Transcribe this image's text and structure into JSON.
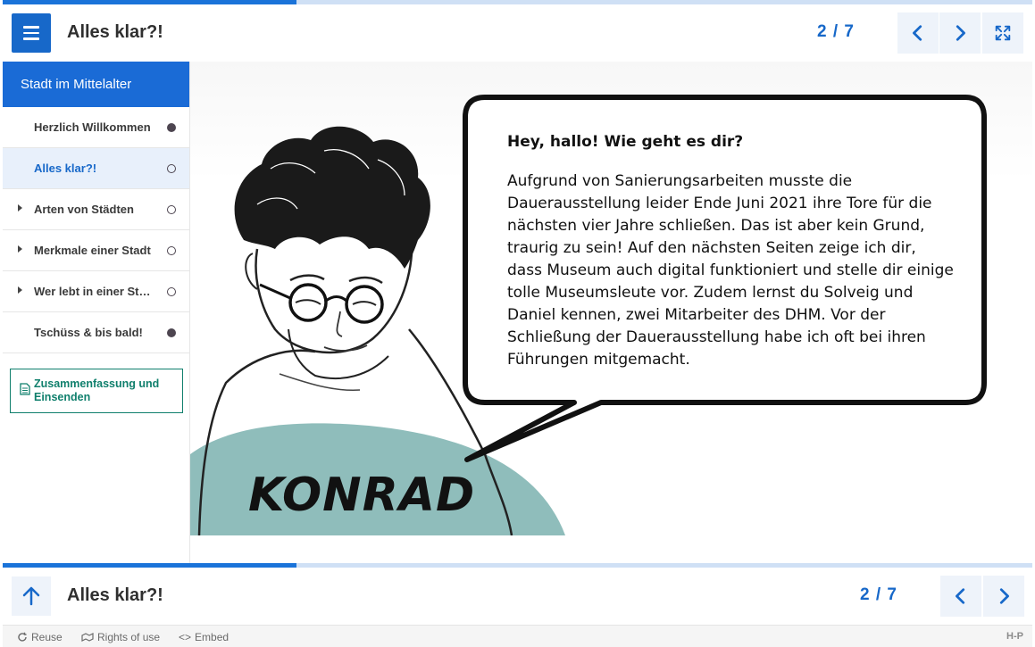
{
  "header": {
    "title": "Alles klar?!",
    "pager": "2 / 7"
  },
  "progress": {
    "fraction": 0.2857
  },
  "sidebar": {
    "heading": "Stadt im Mittelalter",
    "items": [
      {
        "label": "Herzlich Willkommen",
        "status": "filled",
        "expandable": false,
        "active": false
      },
      {
        "label": "Alles klar?!",
        "status": "empty",
        "expandable": false,
        "active": true
      },
      {
        "label": "Arten von Städten",
        "status": "empty",
        "expandable": true,
        "active": false
      },
      {
        "label": "Merkmale einer Stadt",
        "status": "empty",
        "expandable": true,
        "active": false
      },
      {
        "label": "Wer lebt in einer Stadt",
        "status": "empty",
        "expandable": true,
        "active": false
      },
      {
        "label": "Tschüss & bis bald!",
        "status": "filled",
        "expandable": false,
        "active": false
      }
    ],
    "summary_label": "Zusammenfassung und Einsenden"
  },
  "content": {
    "bubble_title": "Hey, hallo! Wie geht es dir?",
    "bubble_body": "Aufgrund von Sanierungsarbeiten musste die Dauerausstellung leider Ende Juni 2021 ihre Tore für die nächsten vier Jahre schließen. Das ist aber kein Grund, traurig zu sein! Auf den nächsten Seiten zeige ich dir, dass Museum auch digital funktioniert und stelle dir einige tolle  Museumsleute vor. Zudem lernst du Solveig und Daniel kennen, zwei Mitarbeiter des DHM. Vor der Schließung der Dauerausstellung habe ich oft bei ihren Führungen mitgemacht.",
    "character_name": "KONRAD"
  },
  "footer": {
    "title": "Alles klar?!",
    "pager": "2 / 7"
  },
  "credits": {
    "reuse": "Reuse",
    "rights": "Rights of use",
    "embed": "Embed",
    "brand": "H-P"
  },
  "colors": {
    "accent": "#1768c9",
    "teal": "#0f7f6c",
    "blob": "#8fbdbb"
  },
  "icons": [
    "menu-icon",
    "chevron-left-icon",
    "chevron-right-icon",
    "fullscreen-icon",
    "arrow-up-icon",
    "document-icon",
    "reuse-icon",
    "rights-icon",
    "embed-icon"
  ]
}
